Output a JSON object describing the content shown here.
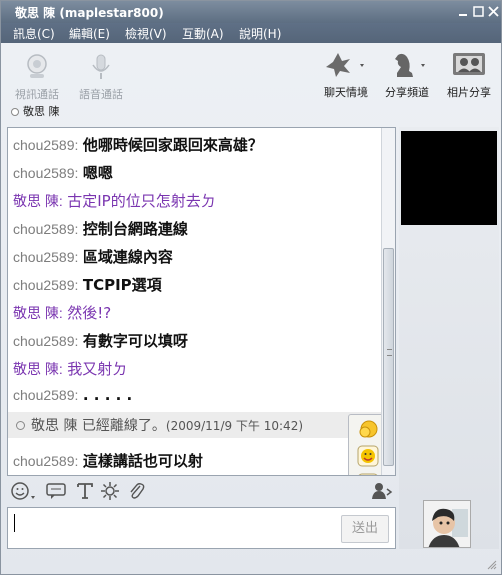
{
  "window": {
    "title": "敬思 陳 (maplestar800)"
  },
  "menu": [
    "訊息(C)",
    "編輯(E)",
    "檢視(V)",
    "互動(A)",
    "說明(H)"
  ],
  "toolbar": {
    "video_call": "視訊通話",
    "voice_call": "語音通話",
    "chat_mood": "聊天情境",
    "share_channel": "分享頻道",
    "photo_share": "相片分享"
  },
  "contact_status": "敬思 陳",
  "messages": [
    {
      "who": "chou2589:",
      "text": "他哪時候回家跟回來高雄？",
      "me": false
    },
    {
      "who": "chou2589:",
      "text": "嗯嗯",
      "me": false
    },
    {
      "who": "敬思 陳:",
      "text": "古定IP的位只怎射去ㄉ",
      "me": true
    },
    {
      "who": "chou2589:",
      "text": "控制台網路連線",
      "me": false
    },
    {
      "who": "chou2589:",
      "text": "區域連線內容",
      "me": false
    },
    {
      "who": "chou2589:",
      "text": "TCPIP選項",
      "me": false
    },
    {
      "who": "敬思 陳:",
      "text": "然後!?",
      "me": true
    },
    {
      "who": "chou2589:",
      "text": "有數字可以填呀",
      "me": false
    },
    {
      "who": "敬思 陳:",
      "text": "我又射ㄉ",
      "me": true
    },
    {
      "who": "chou2589:",
      "text": ". . . . .",
      "me": false
    }
  ],
  "system_line": {
    "text": "敬思 陳 已經離線了。",
    "time": "(2009/11/9 下午 10:42)"
  },
  "last_message": {
    "who": "chou2589:",
    "text": "這樣講話也可以射"
  },
  "input": {
    "value": ""
  },
  "send_label": "送出",
  "colors": {
    "titlebar": "#6a7b8f",
    "self_text": "#7a35b0",
    "other_name": "#7d7d7d"
  }
}
